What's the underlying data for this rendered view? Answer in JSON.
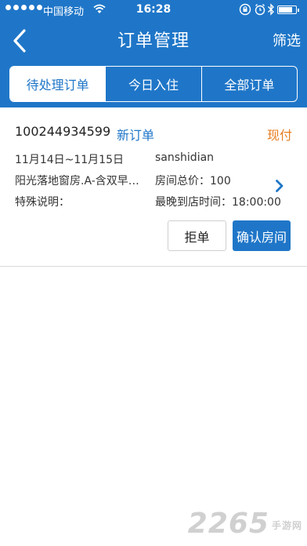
{
  "status_bar": {
    "carrier": "中国移动",
    "time": "16:28"
  },
  "nav": {
    "title": "订单管理",
    "filter_label": "筛选"
  },
  "tabs": [
    {
      "label": "待处理订单",
      "active": true
    },
    {
      "label": "今日入住",
      "active": false
    },
    {
      "label": "全部订单",
      "active": false
    }
  ],
  "order": {
    "id": "100244934599",
    "status": "新订单",
    "payment": "现付",
    "dates": "11月14日~11月15日",
    "guest": "sanshidian",
    "room_type": "阳光落地窗房.A-含双早…",
    "total_price": "房间总价：100",
    "special_note": "特殊说明：",
    "latest_arrival": "最晚到店时间：18:00:00",
    "reject_label": "拒单",
    "confirm_label": "确认房间"
  },
  "watermark": {
    "brand": "2265",
    "site": "手游网"
  },
  "colors": {
    "primary": "#1f76c8",
    "accent_orange": "#e87e22"
  }
}
